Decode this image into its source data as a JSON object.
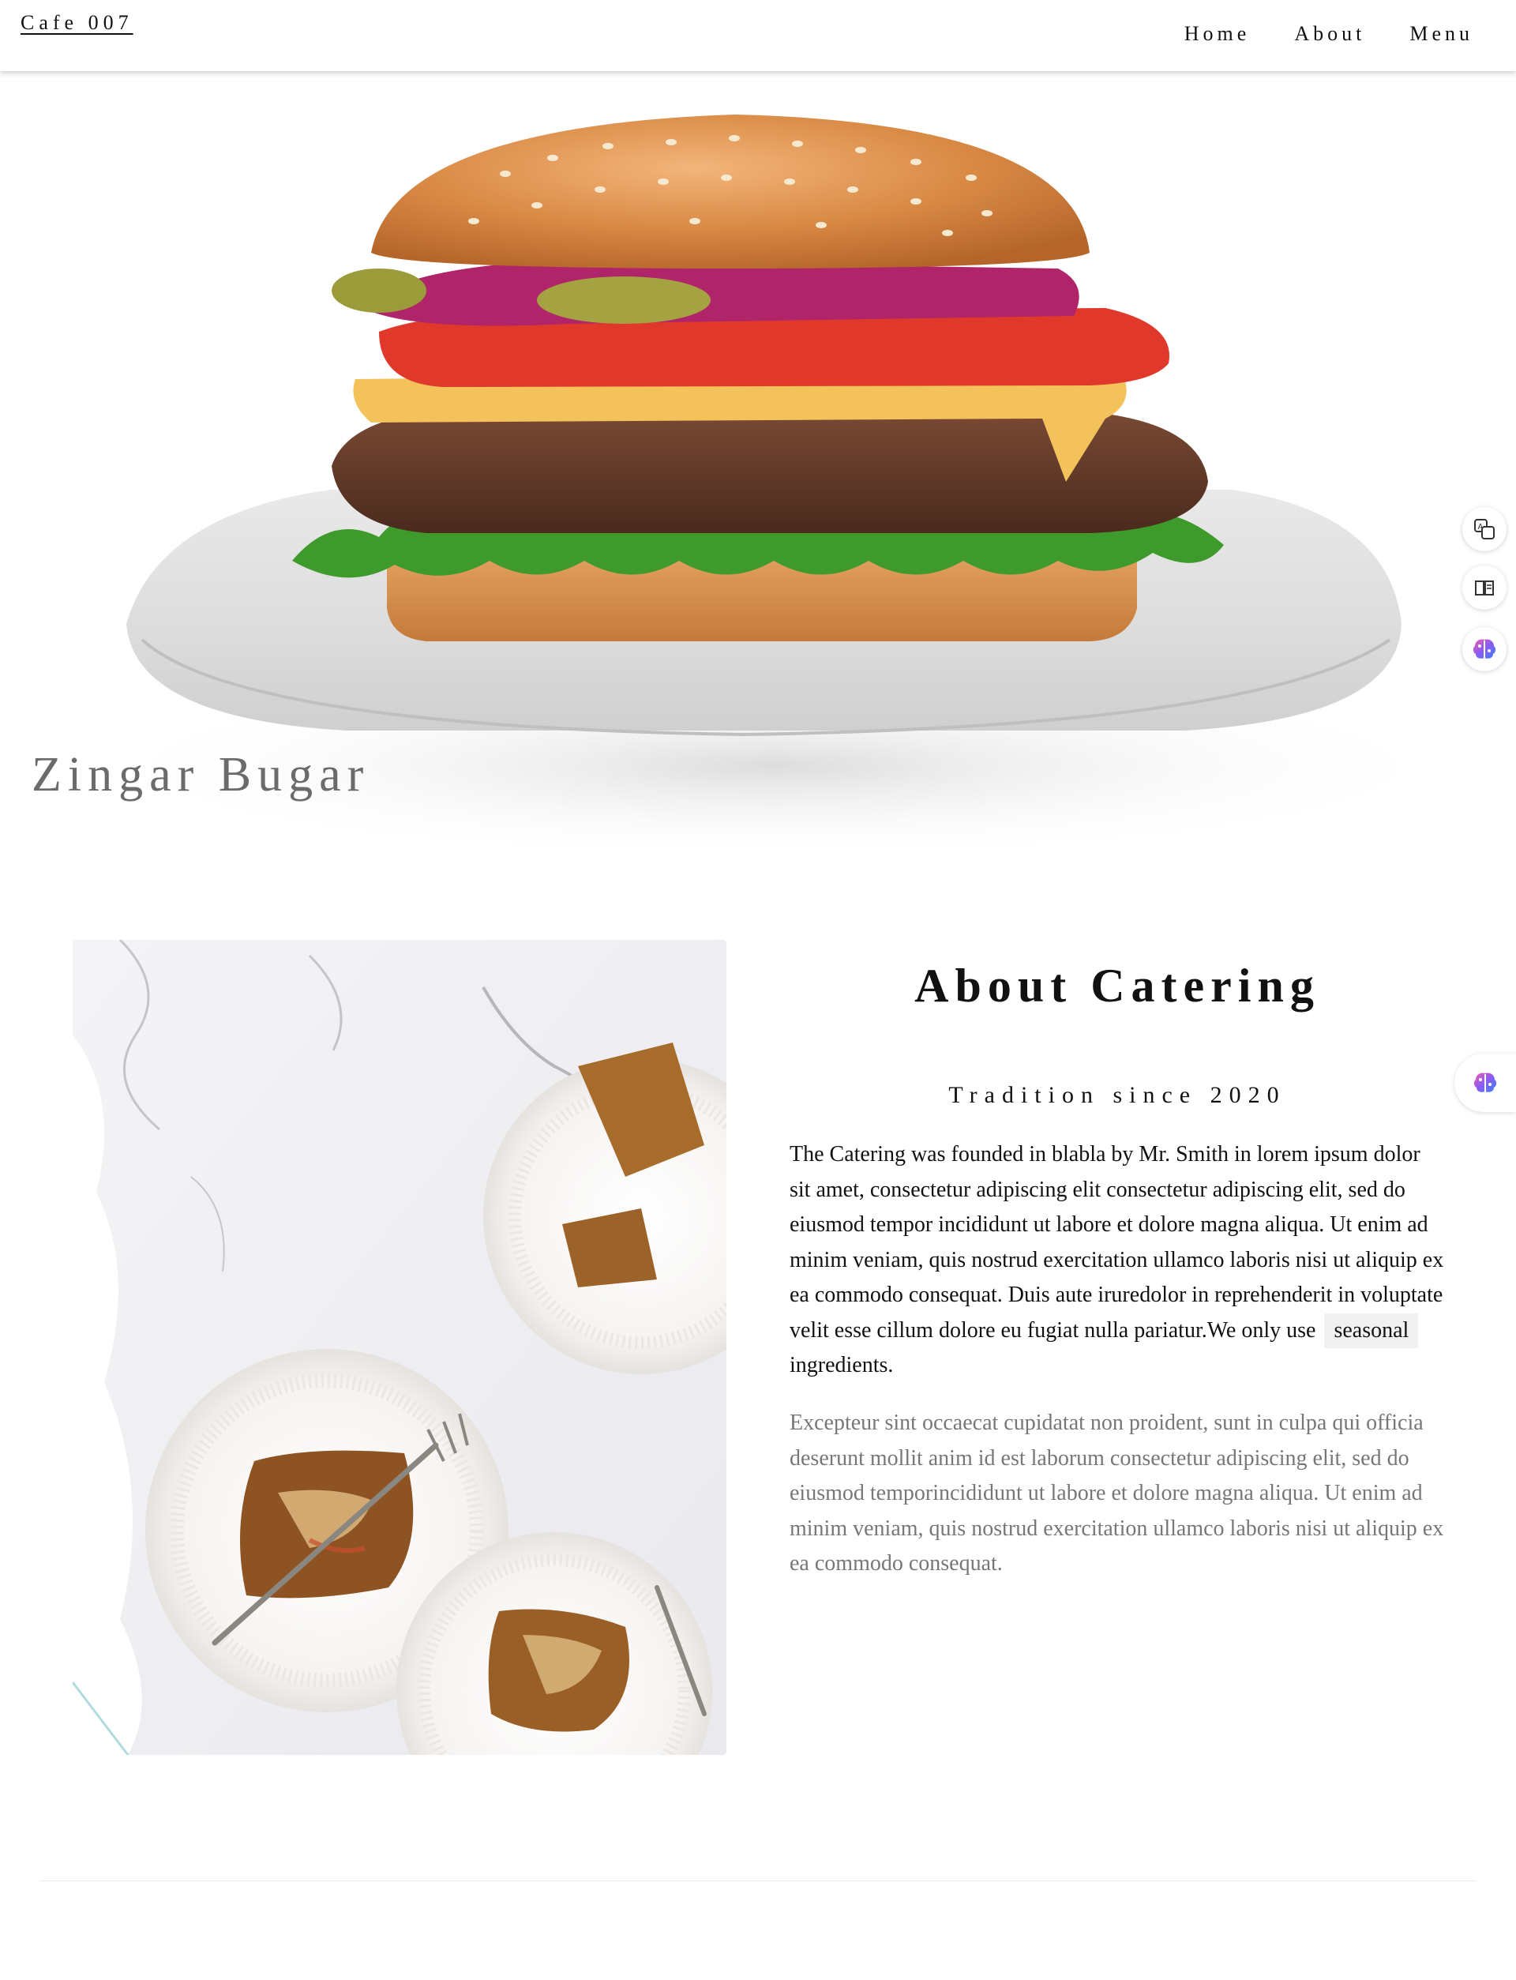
{
  "header": {
    "brand": "Cafe 007",
    "nav": [
      {
        "label": "Home"
      },
      {
        "label": "About"
      },
      {
        "label": "Menu"
      }
    ]
  },
  "hero": {
    "caption": "Zingar Bugar"
  },
  "about": {
    "title": "About Catering",
    "subtitle": "Tradition since 2020",
    "paragraph_main": "The Catering was founded in blabla by Mr. Smith in lorem ipsum dolor sit amet, consectetur adipiscing elit consectetur adipiscing elit, sed do eiusmod tempor incididunt ut labore et dolore magna aliqua. Ut enim ad minim veniam, quis nostrud exercitation ullamco laboris nisi ut aliquip ex ea commodo consequat. Duis aute iruredolor in reprehenderit in voluptate velit esse cillum dolore eu fugiat nulla pariatur.We only use",
    "highlight": "seasonal",
    "paragraph_end": "ingredients.",
    "paragraph_secondary": "Excepteur sint occaecat cupidatat non proident, sunt in culpa qui officia deserunt mollit anim id est laborum consectetur adipiscing elit, sed do eiusmod temporincididunt ut labore et dolore magna aliqua. Ut enim ad minim veniam, quis nostrud exercitation ullamco laboris nisi ut aliquip ex ea commodo consequat."
  },
  "side_tools": [
    {
      "icon": "translate-icon"
    },
    {
      "icon": "reader-icon"
    },
    {
      "icon": "ai-brain-icon"
    }
  ],
  "side_tab": {
    "icon": "ai-brain-icon"
  },
  "colors": {
    "text": "#111111",
    "muted": "#777777",
    "caption": "#6b6b6b",
    "highlight_bg": "#f1f1f1"
  }
}
